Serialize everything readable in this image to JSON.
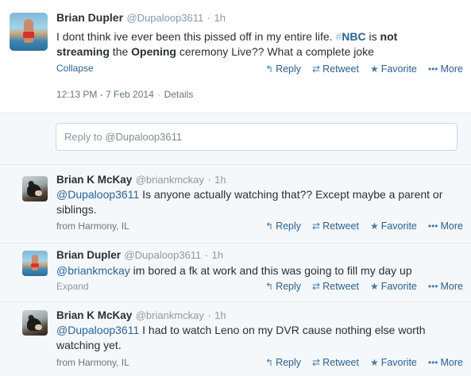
{
  "main_tweet": {
    "name": "Brian Dupler",
    "handle": "@Dupaloop3611",
    "dot": "·",
    "time": "1h",
    "text_parts": {
      "p1": "I dont think ive ever been this pissed off in my entire life. ",
      "hash_symbol": "#",
      "hashtag": "NBC",
      "p2": " is ",
      "bold1": "not streaming",
      "p3": " the ",
      "bold2": "Opening",
      "p4": " ceremony Live?? What a complete joke"
    },
    "collapse": "Collapse",
    "timestamp": "12:13 PM - 7 Feb 2014",
    "sep": "·",
    "details": "Details"
  },
  "actions": {
    "reply": "Reply",
    "retweet": "Retweet",
    "favorite": "Favorite",
    "more": "More",
    "icons": {
      "reply": "reply-arrow-icon",
      "retweet": "retweet-icon",
      "favorite": "star-icon",
      "more": "ellipsis-icon"
    }
  },
  "reply_box": {
    "placeholder_prefix": "Reply to ",
    "placeholder_handle": "@Dupaloop3611"
  },
  "replies": [
    {
      "name": "Brian K McKay",
      "handle": "@briankmckay",
      "dot": "·",
      "time": "1h",
      "mention": "@Dupaloop3611",
      "text": " Is anyone actually watching that?? Except maybe a parent or siblings.",
      "footer": "from Harmony, IL"
    },
    {
      "name": "Brian Dupler",
      "handle": "@Dupaloop3611",
      "dot": "·",
      "time": "1h",
      "mention": "@briankmckay",
      "text": " im bored a fk at work and this was going to fill my day up",
      "footer": "Expand"
    },
    {
      "name": "Brian K McKay",
      "handle": "@briankmckay",
      "dot": "·",
      "time": "1h",
      "mention": "@Dupaloop3611",
      "text": " I had to watch Leno on my DVR cause nothing else worth watching yet.",
      "footer": "from Harmony, IL"
    }
  ]
}
